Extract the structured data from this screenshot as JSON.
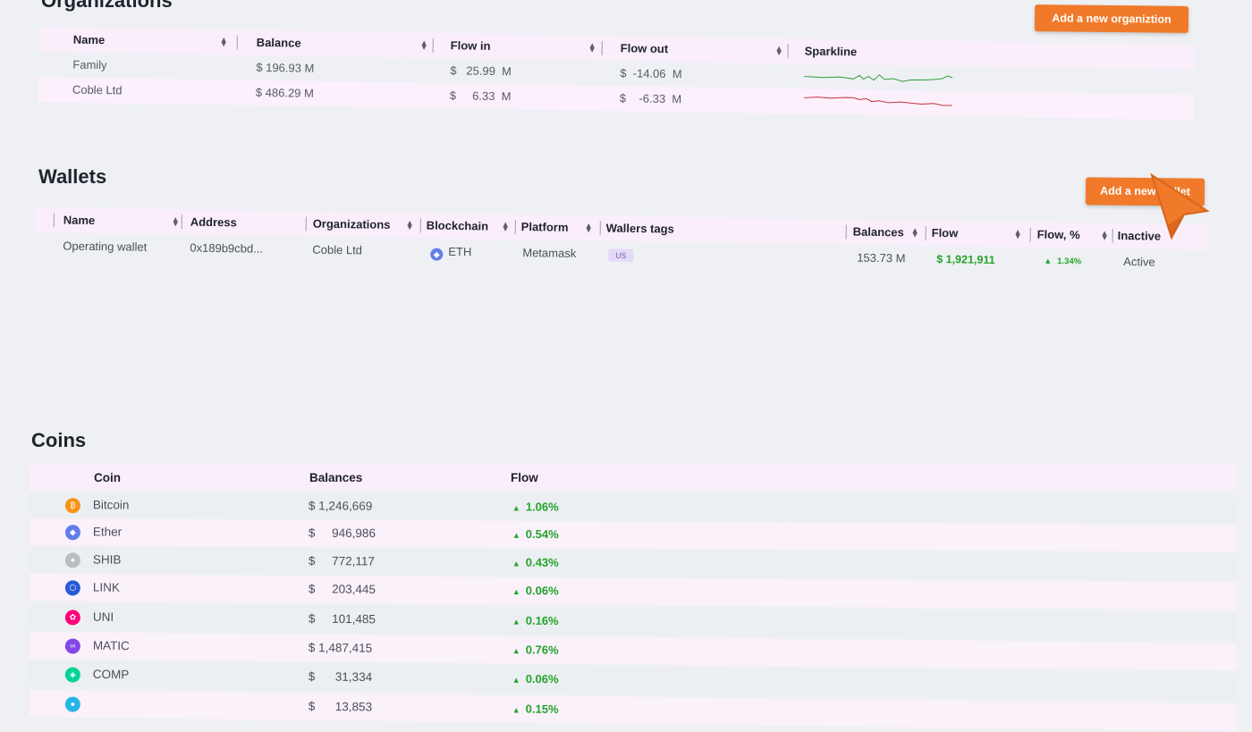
{
  "organizations": {
    "title": "Organizations",
    "add_button": "Add a new organiztion",
    "columns": [
      "Name",
      "Balance",
      "Flow in",
      "Flow out",
      "Sparkline"
    ],
    "rows": [
      {
        "name": "Family",
        "balance": "$ 196.93 M",
        "flow_in": "$   25.99  M",
        "flow_out": "$  -14.06  M",
        "spark_color": "#2e9e3a"
      },
      {
        "name": "Coble Ltd",
        "balance": "$ 486.29 M",
        "flow_in": "$     6.33  M",
        "flow_out": "$    -6.33  M",
        "spark_color": "#c0333a"
      }
    ]
  },
  "wallets": {
    "title": "Wallets",
    "add_button": "Add a new wallet",
    "columns": [
      "Name",
      "Address",
      "Organizations",
      "Blockchain",
      "Platform",
      "Wallers tags",
      "Balances",
      "Flow",
      "Flow, %",
      "Inactive"
    ],
    "rows": [
      {
        "name": "Operating wallet",
        "address": "0x189b9cbd...",
        "organization": "Coble Ltd",
        "blockchain": "ETH",
        "platform": "Metamask",
        "tag": "US",
        "balance": "153.73 M",
        "flow": "$ 1,921,911",
        "flow_pct": "1.34%",
        "status": "Active"
      }
    ]
  },
  "coins": {
    "title": "Coins",
    "columns": [
      "Coin",
      "Balances",
      "Flow"
    ],
    "rows": [
      {
        "name": "Bitcoin",
        "balance": "$ 1,246,669",
        "flow": "1.06%",
        "icon": "bitcoin-icon",
        "color": "#f7931a",
        "glyph": "₿"
      },
      {
        "name": "Ether",
        "balance": "$     946,986",
        "flow": "0.54%",
        "icon": "ether-icon",
        "color": "#627eea",
        "glyph": "◆"
      },
      {
        "name": "SHIB",
        "balance": "$     772,117",
        "flow": "0.43%",
        "icon": "shib-icon",
        "color": "#b9bcc2",
        "glyph": "●"
      },
      {
        "name": "LINK",
        "balance": "$     203,445",
        "flow": "0.06%",
        "icon": "link-icon",
        "color": "#2a5ada",
        "glyph": "⬡"
      },
      {
        "name": "UNI",
        "balance": "$     101,485",
        "flow": "0.16%",
        "icon": "uni-icon",
        "color": "#ff007a",
        "glyph": "✿"
      },
      {
        "name": "MATIC",
        "balance": "$ 1,487,415",
        "flow": "0.76%",
        "icon": "matic-icon",
        "color": "#8247e5",
        "glyph": "∞"
      },
      {
        "name": "COMP",
        "balance": "$      31,334",
        "flow": "0.06%",
        "icon": "comp-icon",
        "color": "#00d395",
        "glyph": "◈"
      },
      {
        "name": "",
        "balance": "$      13,853",
        "flow": "0.15%",
        "icon": "coin-icon",
        "color": "#27b5e8",
        "glyph": "●"
      }
    ]
  }
}
